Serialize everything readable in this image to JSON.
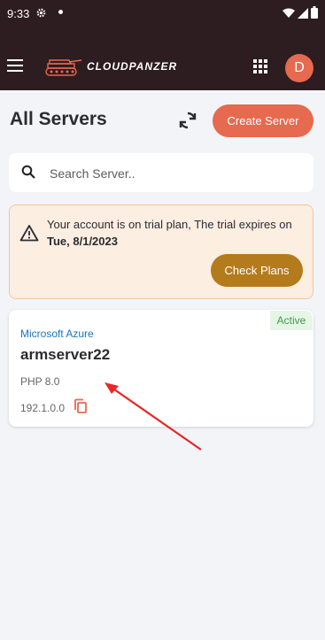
{
  "status": {
    "time": "9:33"
  },
  "header": {
    "logo": "CLOUDPANZER",
    "avatar_letter": "D"
  },
  "page": {
    "title": "All Servers",
    "create_label": "Create Server"
  },
  "search": {
    "placeholder": "Search Server.."
  },
  "trial": {
    "message": "Your account is on trial plan, The trial expires on",
    "date": "Tue, 8/1/2023",
    "button": "Check Plans"
  },
  "servers": [
    {
      "status": "Active",
      "provider": "Microsoft Azure",
      "name": "armserver22",
      "php": "PHP 8.0",
      "ip": "192.1.0.0"
    }
  ],
  "colors": {
    "header_bg": "#2d1c20",
    "accent": "#e66a4f",
    "trial_button": "#b47b1d",
    "active_green": "#3e9a4a",
    "provider_blue": "#1776c0",
    "annotation_red": "#e82727"
  }
}
